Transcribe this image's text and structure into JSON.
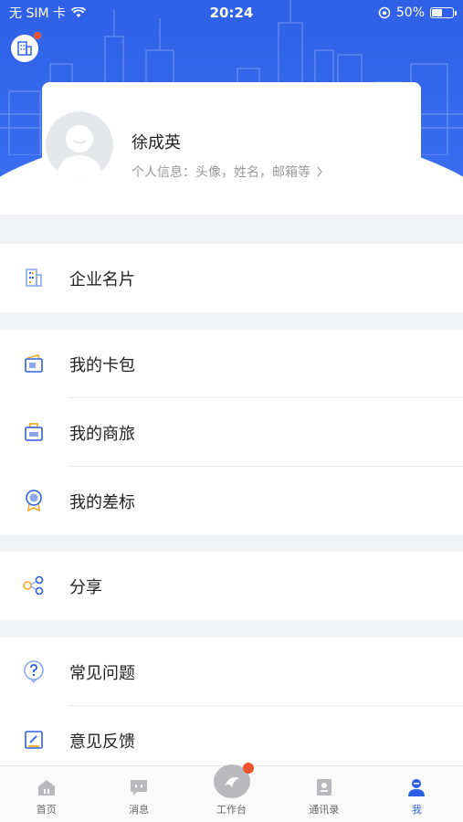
{
  "status_bar": {
    "carrier": "无 SIM 卡",
    "time": "20:24",
    "battery_text": "50%",
    "battery_level": 0.5
  },
  "profile": {
    "name": "徐成英",
    "info_hint": "个人信息：头像，姓名，邮箱等"
  },
  "menu": {
    "business_card": "企业名片",
    "card_wallet": "我的卡包",
    "business_travel": "我的商旅",
    "benchmark": "我的差标",
    "share": "分享",
    "faq": "常见问题",
    "feedback": "意见反馈"
  },
  "tabbar": {
    "items": [
      {
        "label": "首页",
        "icon": "home-icon"
      },
      {
        "label": "消息",
        "icon": "message-icon"
      },
      {
        "label": "工作台",
        "icon": "workbench-icon"
      },
      {
        "label": "通讯录",
        "icon": "contacts-icon"
      },
      {
        "label": "我",
        "icon": "profile-icon"
      }
    ],
    "active_index": 4
  },
  "colors": {
    "brand_blue": "#2d5fe6",
    "badge_red": "#f0522e",
    "icon_orange": "#f5a623"
  }
}
